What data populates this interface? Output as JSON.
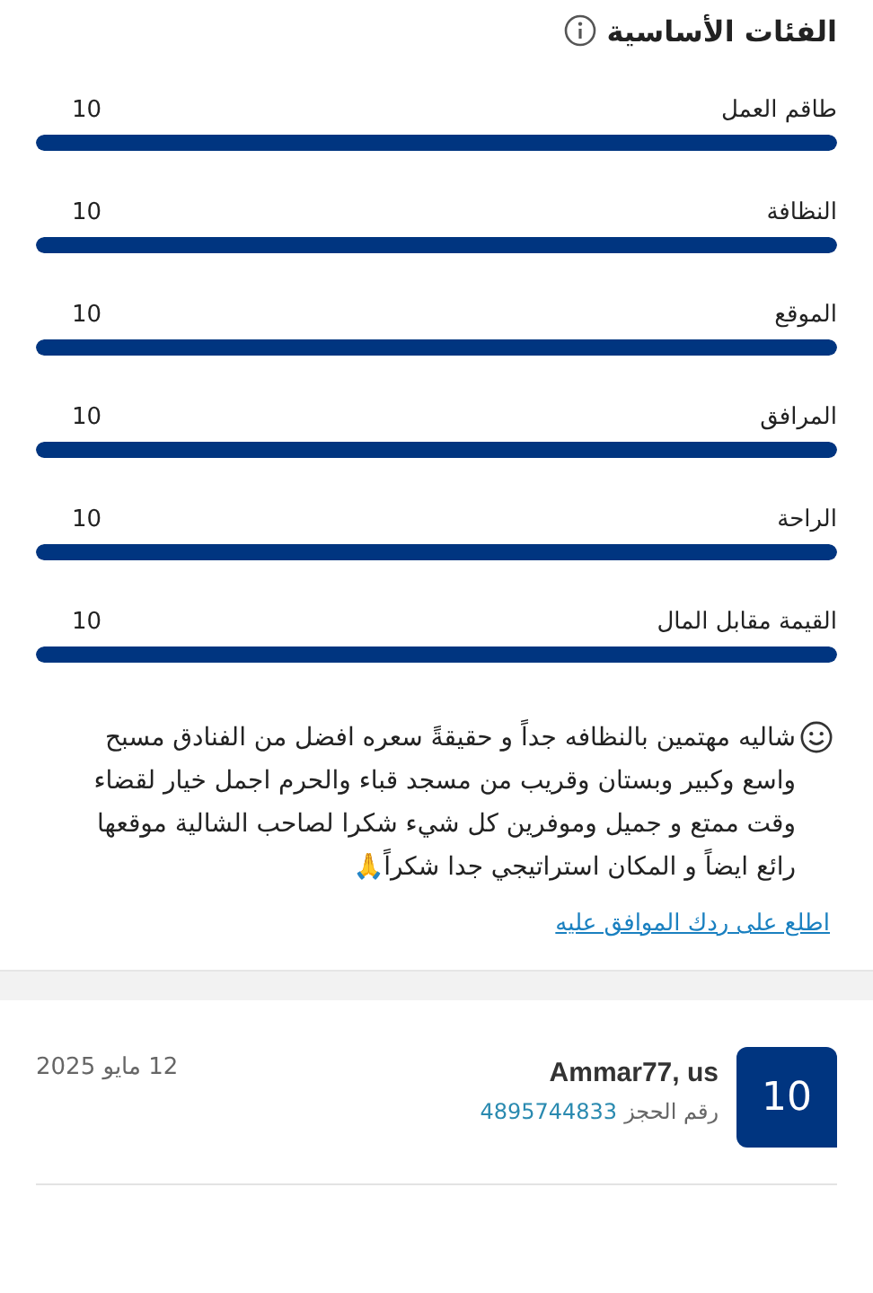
{
  "section": {
    "title": "الفئات الأساسية"
  },
  "categories": [
    {
      "label": "طاقم العمل",
      "score": "10",
      "level": 1
    },
    {
      "label": "النظافة",
      "score": "10",
      "level": 1
    },
    {
      "label": "الموقع",
      "score": "10",
      "level": 1
    },
    {
      "label": "المرافق",
      "score": "10",
      "level": 1
    },
    {
      "label": "الراحة",
      "score": "10",
      "level": 1
    },
    {
      "label": "القيمة مقابل المال",
      "score": "10",
      "level": 1
    }
  ],
  "review": {
    "text": "شاليه مهتمين بالنظافه جداً و حقيقةً سعره افضل من الفنادق مسبح واسع وكبير وبستان وقريب من مسجد قباء والحرم اجمل خيار لقضاء وقت ممتع و جميل وموفرين كل شيء شكرا لصاحب الشالية موقعها رائع ايضاً و المكان استراتيجي جدا شكراً🙏",
    "link": "اطلع على ردك الموافق عليه"
  },
  "reviewer": {
    "score": "10",
    "name": "Ammar77, us",
    "booking_label": "رقم الحجز",
    "booking_number": "4895744833",
    "date": "12 مايو 2025"
  }
}
